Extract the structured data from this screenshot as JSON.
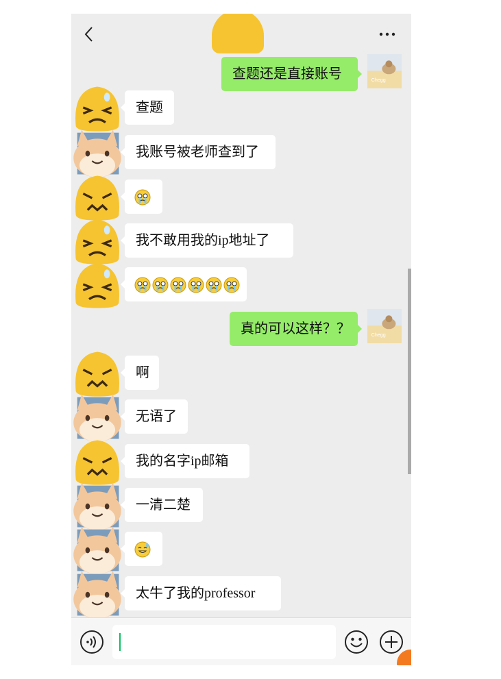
{
  "header": {
    "back_icon": "chevron-left-icon",
    "more_icon": "ellipsis-icon"
  },
  "messages": [
    {
      "side": "right",
      "text": "查题还是直接账号",
      "avatar": "cat-photo-chegg"
    },
    {
      "side": "left",
      "text": "查题",
      "avatar": "yellow-face-squint"
    },
    {
      "side": "left",
      "text": "我账号被老师查到了",
      "avatar": "hamster-face"
    },
    {
      "side": "left",
      "text": "",
      "emoji": [
        "crying-face"
      ],
      "avatar": "yellow-face-angry"
    },
    {
      "side": "left",
      "text": "我不敢用我的ip地址了",
      "avatar": "yellow-face-squint"
    },
    {
      "side": "left",
      "text": "",
      "emoji": [
        "crying-face",
        "crying-face",
        "crying-face",
        "crying-face",
        "crying-face",
        "crying-face"
      ],
      "avatar": "yellow-face-squint"
    },
    {
      "side": "right",
      "text": "真的可以这样？？",
      "avatar": "cat-photo-chegg"
    },
    {
      "side": "left",
      "text": "啊",
      "avatar": "yellow-face-angry"
    },
    {
      "side": "left",
      "text": "无语了",
      "avatar": "hamster-face"
    },
    {
      "side": "left",
      "text": "我的名字ip邮箱",
      "avatar": "yellow-face-angry"
    },
    {
      "side": "left",
      "text": "一清二楚",
      "avatar": "hamster-face"
    },
    {
      "side": "left",
      "text": "",
      "emoji": [
        "sweat-smile-face"
      ],
      "avatar": "hamster-face"
    },
    {
      "side": "left",
      "text": "太牛了我的professor",
      "avatar": "hamster-face"
    }
  ],
  "input_bar": {
    "voice_icon": "voice-icon",
    "text_value": "",
    "emoji_icon": "emoji-icon",
    "plus_icon": "plus-icon"
  },
  "colors": {
    "background": "#ededed",
    "bubble_self": "#95ec69",
    "bubble_other": "#ffffff",
    "accent": "#07c160"
  }
}
